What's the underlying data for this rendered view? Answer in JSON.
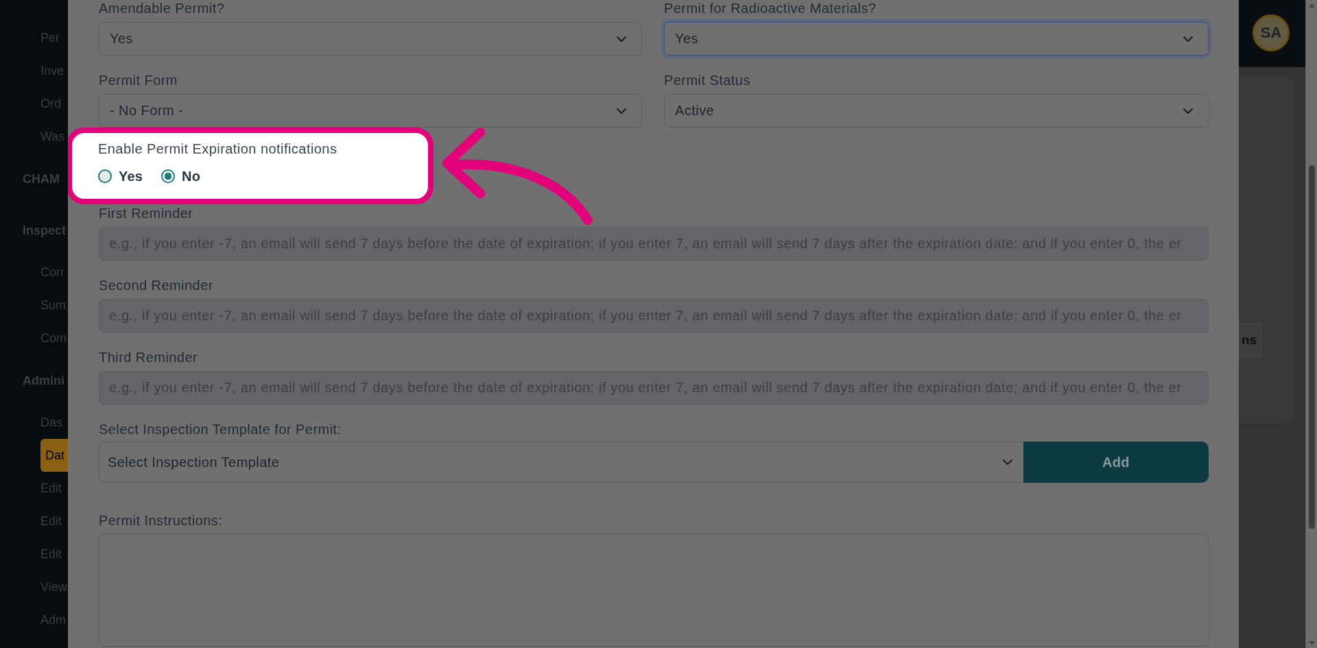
{
  "sidebar": {
    "sections": [
      {
        "items": [
          {
            "label": "Per",
            "selected": false
          },
          {
            "label": "Inve",
            "selected": false
          },
          {
            "label": "Ord",
            "selected": false
          },
          {
            "label": "Was",
            "selected": false
          }
        ]
      },
      {
        "heading": "CHAM"
      },
      {
        "heading": "Inspect",
        "items": [
          {
            "label": "Corr",
            "selected": false
          },
          {
            "label": "Sum",
            "selected": false
          },
          {
            "label": "Com",
            "selected": false
          }
        ]
      },
      {
        "heading": "Admini",
        "items": [
          {
            "label": "Das",
            "selected": false
          },
          {
            "label": "Dat",
            "selected": true
          },
          {
            "label": "Edit",
            "selected": false
          },
          {
            "label": "Edit",
            "selected": false
          },
          {
            "label": "Edit",
            "selected": false
          },
          {
            "label": "View",
            "selected": false
          },
          {
            "label": "Adm",
            "selected": false
          }
        ]
      }
    ]
  },
  "top_bar": {
    "avatar": "SA"
  },
  "page": {
    "button": "ns"
  },
  "dialog": {
    "selects": [
      {
        "label": "Amendable Permit?",
        "value": "Yes",
        "focused": false
      },
      {
        "label": "Permit for Radioactive Materials?",
        "value": "Yes",
        "focused": true
      },
      {
        "label": "Permit Form",
        "value": "- No Form -",
        "focused": false
      },
      {
        "label": "Permit Status",
        "value": "Active",
        "focused": false
      }
    ],
    "expiration_notifications": {
      "label": "Enable Permit Expiration notifications",
      "highlighted": true,
      "options": [
        {
          "label": "Yes",
          "selected": false
        },
        {
          "label": "No",
          "selected": true
        }
      ]
    },
    "reminders": [
      {
        "label": "First Reminder",
        "placeholder": "e.g., if you enter -7, an email will send 7 days before the date of expiration; if you enter 7, an email will send 7 days after the expiration date; and if you enter 0, the er",
        "disabled": true
      },
      {
        "label": "Second Reminder",
        "placeholder": "e.g., if you enter -7, an email will send 7 days before the date of expiration; if you enter 7, an email will send 7 days after the expiration date; and if you enter 0, the er",
        "disabled": true
      },
      {
        "label": "Third Reminder",
        "placeholder": "e.g., if you enter -7, an email will send 7 days before the date of expiration; if you enter 7, an email will send 7 days after the expiration date; and if you enter 0, the er",
        "disabled": true
      }
    ],
    "inspection_template": {
      "label": "Select Inspection Template for Permit:",
      "value": "Select Inspection Template",
      "button": "Add"
    },
    "instructions": {
      "label": "Permit Instructions:"
    }
  }
}
